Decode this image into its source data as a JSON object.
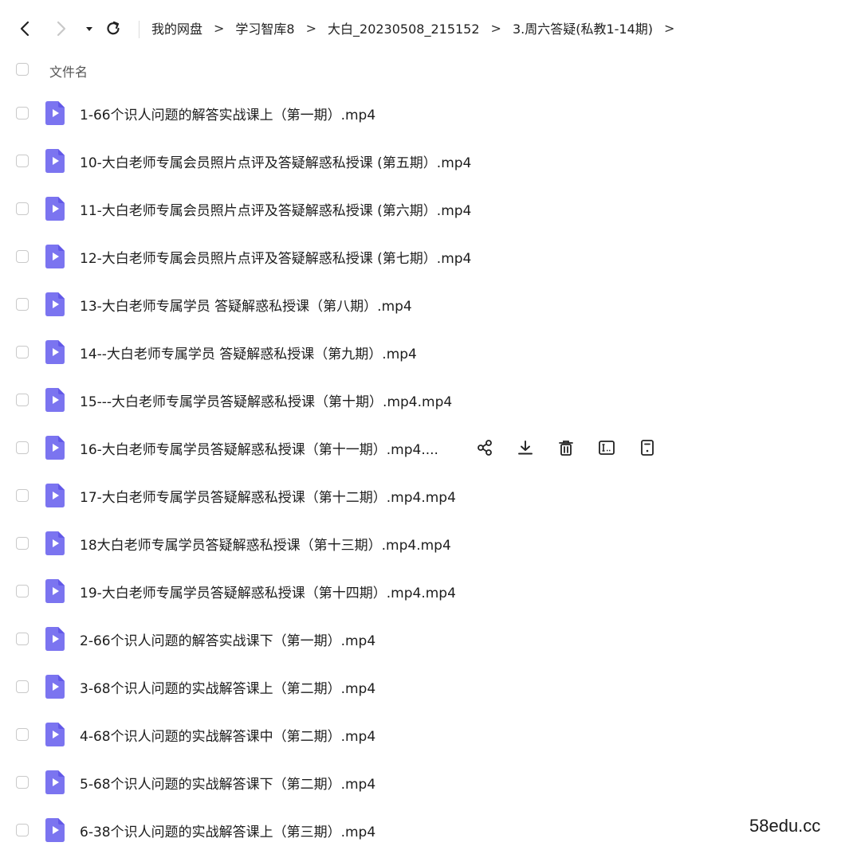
{
  "breadcrumb": [
    {
      "label": "我的网盘"
    },
    {
      "label": "学习智库8"
    },
    {
      "label": "大白_20230508_215152"
    },
    {
      "label": "3.周六答疑(私教1-14期)"
    }
  ],
  "breadcrumb_separator": ">",
  "list_header": {
    "name_label": "文件名"
  },
  "files": [
    {
      "name": "1-66个识人问题的解答实战课上（第一期）.mp4"
    },
    {
      "name": "10-大白老师专属会员照片点评及答疑解惑私授课 (第五期）.mp4"
    },
    {
      "name": "11-大白老师专属会员照片点评及答疑解惑私授课 (第六期）.mp4"
    },
    {
      "name": "12-大白老师专属会员照片点评及答疑解惑私授课 (第七期）.mp4"
    },
    {
      "name": "13-大白老师专属学员 答疑解惑私授课（第八期）.mp4"
    },
    {
      "name": "14--大白老师专属学员 答疑解惑私授课（第九期）.mp4"
    },
    {
      "name": "15---大白老师专属学员答疑解惑私授课（第十期）.mp4.mp4"
    },
    {
      "name": "16-大白老师专属学员答疑解惑私授课（第十一期）.mp4...."
    },
    {
      "name": "17-大白老师专属学员答疑解惑私授课（第十二期）.mp4.mp4"
    },
    {
      "name": "18大白老师专属学员答疑解惑私授课（第十三期）.mp4.mp4"
    },
    {
      "name": "19-大白老师专属学员答疑解惑私授课（第十四期）.mp4.mp4"
    },
    {
      "name": "2-66个识人问题的解答实战课下（第一期）.mp4"
    },
    {
      "name": "3-68个识人问题的实战解答课上（第二期）.mp4"
    },
    {
      "name": "4-68个识人问题的实战解答课中（第二期）.mp4"
    },
    {
      "name": "5-68个识人问题的实战解答课下（第二期）.mp4"
    },
    {
      "name": "6-38个识人问题的实战解答课上（第三期）.mp4"
    }
  ],
  "hovered_row_actions": [
    "share-icon",
    "download-icon",
    "delete-icon",
    "rename-icon",
    "more-icon"
  ],
  "colors": {
    "file_icon": "#7b74f0",
    "file_icon_dark": "#6258e8",
    "text": "#1d1d1d"
  },
  "watermark": "58edu.cc"
}
